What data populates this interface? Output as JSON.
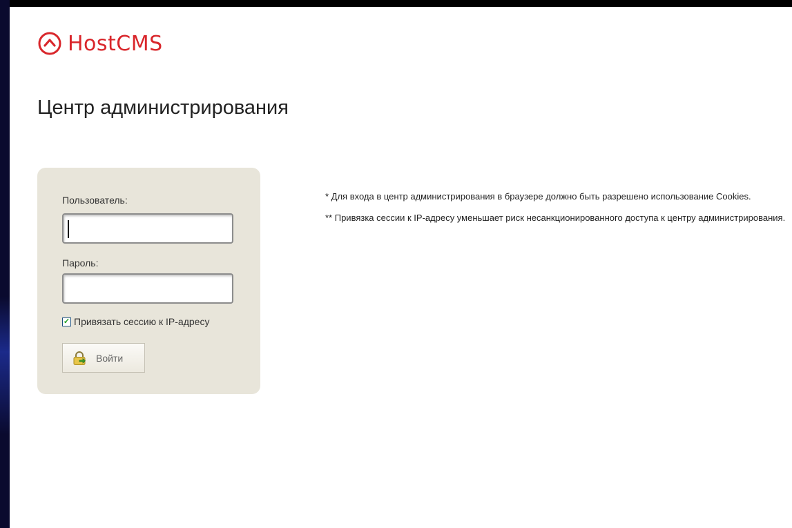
{
  "brand": {
    "name": "HostCMS",
    "logo_icon": "chevron-up-circle-icon",
    "color": "#d9262b"
  },
  "page": {
    "title": "Центр администрирования"
  },
  "login_form": {
    "user_label": "Пользователь:",
    "user_value": "",
    "password_label": "Пароль:",
    "password_value": "",
    "bind_session_label": "Привязать сессию к IP-адресу",
    "bind_session_checked": true,
    "submit_label": "Войти",
    "submit_icon": "lock-icon"
  },
  "notes": [
    "* Для входа в центр администрирования в браузере должно быть разрешено использование Cookies.",
    "** Привязка сессии к IP-адресу уменьшает риск несанкционированного доступа к центру администрирования."
  ],
  "colors": {
    "box_background": "#e8e5da",
    "accent": "#d9262b"
  }
}
